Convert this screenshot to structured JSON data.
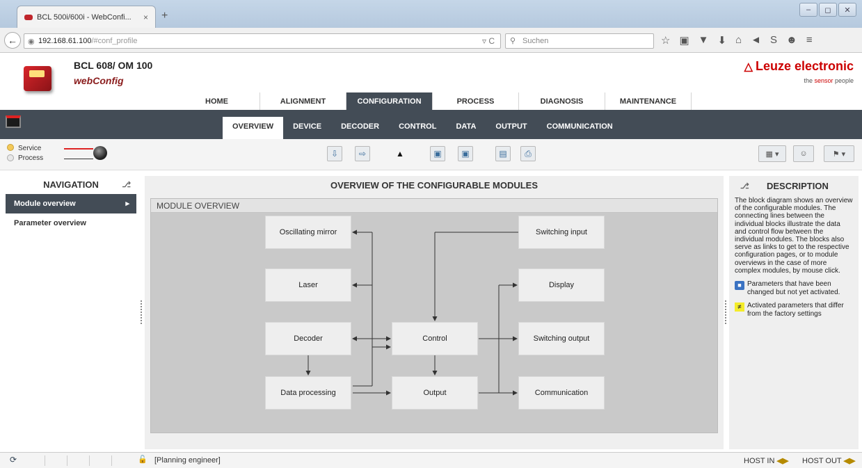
{
  "browser": {
    "tab_title": "BCL 500i/600i - WebConfi...",
    "tab_close": "×",
    "new_tab": "+",
    "window_buttons": [
      "–",
      "◻",
      "✕"
    ],
    "url_host": "192.168.61.100",
    "url_path": "/#conf_profile",
    "url_reload": "▿ C",
    "search_placeholder": "Suchen",
    "toolbar_icons": [
      "☆",
      "▣",
      "▼",
      "⬇",
      "⌂",
      "◄",
      "S",
      "☻",
      "≡"
    ]
  },
  "header": {
    "product": "BCL 608/ OM 100",
    "app": "webConfig",
    "brand": "Leuze electronic",
    "tagline_pre": "the ",
    "tagline_hi": "sensor",
    "tagline_post": " people"
  },
  "main_tabs": [
    "HOME",
    "ALIGNMENT",
    "CONFIGURATION",
    "PROCESS",
    "DIAGNOSIS",
    "MAINTENANCE"
  ],
  "active_main_tab": "CONFIGURATION",
  "sub_tabs": [
    "OVERVIEW",
    "DEVICE",
    "DECODER",
    "CONTROL",
    "DATA",
    "OUTPUT",
    "COMMUNICATION"
  ],
  "active_sub_tab": "OVERVIEW",
  "status": {
    "service": "Service",
    "process": "Process"
  },
  "navigation": {
    "title": "NAVIGATION",
    "items": [
      {
        "label": "Module overview",
        "active": true
      },
      {
        "label": "Parameter overview",
        "active": false
      }
    ]
  },
  "main": {
    "title": "OVERVIEW OF THE CONFIGURABLE MODULES",
    "section": "MODULE OVERVIEW",
    "blocks": {
      "oscillating_mirror": "Oscillating mirror",
      "laser": "Laser",
      "decoder": "Decoder",
      "data_processing": "Data processing",
      "control": "Control",
      "output": "Output",
      "switching_input": "Switching input",
      "display": "Display",
      "switching_output": "Switching output",
      "communication": "Communication"
    }
  },
  "description": {
    "title": "DESCRIPTION",
    "text": "The block diagram shows an overview of the configurable modules. The connecting lines between the individual blocks illustrate the data and control flow between the individual modules. The blocks also serve as links to get to the respective configuration pages, or to module overviews in the case of more complex modules, by mouse click.",
    "legend_changed": "Parameters that have been changed but not yet activated.",
    "legend_differ": "Activated parameters that differ from the factory settings",
    "legend_mark": "≠"
  },
  "statusbar": {
    "role": "[Planning engineer]",
    "host_in": "HOST IN",
    "host_out": "HOST OUT"
  },
  "colors": {
    "accent": "#cc0000",
    "dark_nav": "#434c56"
  }
}
